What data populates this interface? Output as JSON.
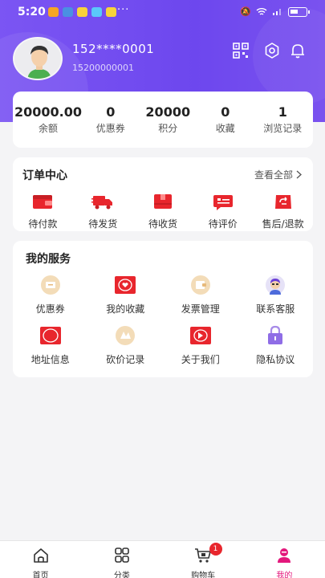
{
  "status_bar": {
    "time": "5:20",
    "more": "···"
  },
  "profile": {
    "name": "152****0001",
    "phone": "15200000001"
  },
  "stats": [
    {
      "value": "20000.00",
      "label": "余额"
    },
    {
      "value": "0",
      "label": "优惠券"
    },
    {
      "value": "20000",
      "label": "积分"
    },
    {
      "value": "0",
      "label": "收藏"
    },
    {
      "value": "1",
      "label": "浏览记录"
    }
  ],
  "orders": {
    "title": "订单中心",
    "view_all": "查看全部",
    "items": [
      {
        "label": "待付款",
        "icon": "wallet-icon"
      },
      {
        "label": "待发货",
        "icon": "truck-icon"
      },
      {
        "label": "待收货",
        "icon": "box-icon"
      },
      {
        "label": "待评价",
        "icon": "comment-icon"
      },
      {
        "label": "售后/退款",
        "icon": "refund-icon"
      }
    ]
  },
  "services": {
    "title": "我的服务",
    "items": [
      {
        "label": "优惠券",
        "icon": "coupon-icon"
      },
      {
        "label": "我的收藏",
        "icon": "favorite-icon"
      },
      {
        "label": "发票管理",
        "icon": "invoice-icon"
      },
      {
        "label": "联系客服",
        "icon": "customer-service-icon"
      },
      {
        "label": "地址信息",
        "icon": "address-icon"
      },
      {
        "label": "砍价记录",
        "icon": "bargain-icon"
      },
      {
        "label": "关于我们",
        "icon": "about-icon"
      },
      {
        "label": "隐私协议",
        "icon": "lock-icon"
      }
    ]
  },
  "tabbar": {
    "cart_badge": "1",
    "items": [
      {
        "label": "首页",
        "icon": "home-icon"
      },
      {
        "label": "分类",
        "icon": "category-icon"
      },
      {
        "label": "购物车",
        "icon": "cart-icon"
      },
      {
        "label": "我的",
        "icon": "profile-icon"
      }
    ],
    "active": "我的"
  },
  "colors": {
    "header": "#7050f0",
    "accent_red": "#e8262d",
    "active_tab": "#e3187c"
  }
}
